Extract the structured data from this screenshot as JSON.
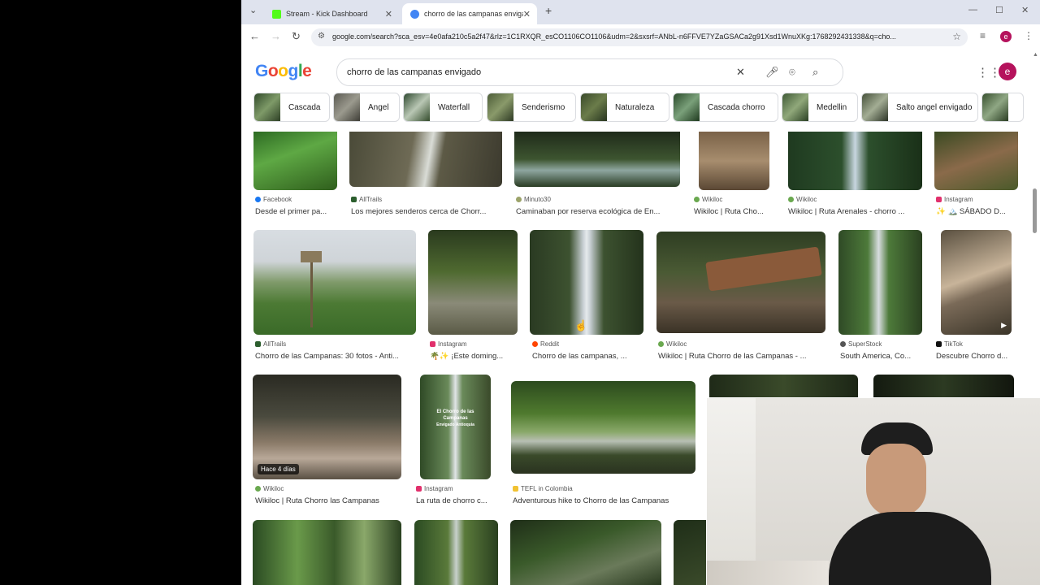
{
  "browser": {
    "tabs": [
      {
        "title": "Stream - Kick Dashboard",
        "favicon_color": "#53fc18",
        "active": false
      },
      {
        "title": "chorro de las campanas envigado",
        "favicon_color": "#4285f4",
        "active": true
      }
    ],
    "new_tab": "+",
    "url": "google.com/search?sca_esv=4e0afa210c5a2f47&rlz=1C1RXQR_esCO1106CO1106&udm=2&sxsrf=ANbL-n6FFVE7YZaGSACa2g91Xsd1WnuXKg:1768292431338&q=cho...",
    "profile_initial": "e"
  },
  "google": {
    "logo_letters": [
      "G",
      "o",
      "o",
      "g",
      "l",
      "e"
    ],
    "logo_colors": [
      "#4285f4",
      "#ea4335",
      "#fbbc05",
      "#4285f4",
      "#34a853",
      "#ea4335"
    ],
    "query": "chorro de las campanas envigado",
    "profile_initial": "e"
  },
  "chips": [
    {
      "label": "Cascada"
    },
    {
      "label": "Angel"
    },
    {
      "label": "Waterfall"
    },
    {
      "label": "Senderismo"
    },
    {
      "label": "Naturaleza"
    },
    {
      "label": "Cascada chorro"
    },
    {
      "label": "Medellin"
    },
    {
      "label": "Salto angel envigado"
    }
  ],
  "results": {
    "row1": [
      {
        "source": "Facebook",
        "caption": "Desde el primer pa...",
        "src_color": "#1877f2"
      },
      {
        "source": "AllTrails",
        "caption": "Los mejores senderos cerca de Chorr...",
        "src_color": "#2c5e2e"
      },
      {
        "source": "Minuto30",
        "caption": "Caminaban por reserva ecológica de En...",
        "src_color": "#9ca36a"
      },
      {
        "source": "Wikiloc",
        "caption": "Wikiloc | Ruta Cho...",
        "src_color": "#6aa84f"
      },
      {
        "source": "Wikiloc",
        "caption": "Wikiloc | Ruta Arenales - chorro ...",
        "src_color": "#6aa84f"
      },
      {
        "source": "Instagram",
        "caption": "✨ 🏔️ SÁBADO D...",
        "src_color": "#e1306c"
      }
    ],
    "row2": [
      {
        "source": "AllTrails",
        "caption": "Chorro de las Campanas: 30 fotos - Anti...",
        "src_color": "#2c5e2e"
      },
      {
        "source": "Instagram",
        "caption": "🌴✨ ¡Este doming...",
        "src_color": "#e1306c"
      },
      {
        "source": "Reddit",
        "caption": "Chorro de las campanas, ...",
        "src_color": "#ff4500"
      },
      {
        "source": "Wikiloc",
        "caption": "Wikiloc | Ruta Chorro de las Campanas - ...",
        "src_color": "#6aa84f"
      },
      {
        "source": "SuperStock",
        "caption": "South America, Co...",
        "src_color": "#555555"
      },
      {
        "source": "TikTok",
        "caption": "Descubre Chorro d...",
        "src_color": "#111111"
      }
    ],
    "row3": [
      {
        "source": "Wikiloc",
        "caption": "Wikiloc | Ruta Chorro las Campanas",
        "src_color": "#6aa84f",
        "badge": "Hace 4 días"
      },
      {
        "source": "Instagram",
        "caption": "La ruta de chorro c...",
        "src_color": "#e1306c"
      },
      {
        "source": "TEFL in Colombia",
        "caption": "Adventurous hike to Chorro de las Campanas",
        "src_color": "#f1c232"
      }
    ],
    "overlay_text": [
      "El Chorro de las",
      "Campanas",
      "Envigado Antioquia"
    ]
  }
}
